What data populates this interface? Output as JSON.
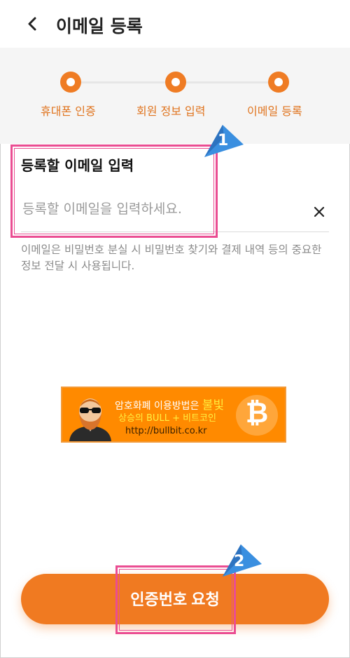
{
  "header": {
    "title": "이메일 등록"
  },
  "steps": [
    {
      "label": "휴대폰 인증"
    },
    {
      "label": "회원 정보 입력"
    },
    {
      "label": "이메일 등록"
    }
  ],
  "form": {
    "field_title": "등록할 이메일 입력",
    "placeholder": "등록할 이메일을 입력하세요.",
    "value": "",
    "description": "이메일은 비밀번호 분실 시 비밀번호 찾기와 결제 내역 등의 중요한 정보 전달 시 사용됩니다."
  },
  "banner": {
    "line1_prefix": "암호화폐 이용방법은 ",
    "line1_highlight": "불빛",
    "line2": "상승의 BULL + 비트코인",
    "line3": "http://bullbit.co.kr",
    "coin_symbol": "₿"
  },
  "cta": {
    "label": "인증번호 요청"
  },
  "annotations": [
    {
      "number": "1"
    },
    {
      "number": "2"
    }
  ],
  "colors": {
    "accent": "#f07a21",
    "highlight": "#ea4d92",
    "badge": "#3a8fe0"
  }
}
